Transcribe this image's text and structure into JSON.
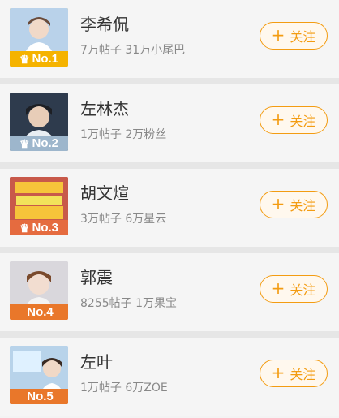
{
  "users": [
    {
      "rank": "No.1",
      "name": "李希侃",
      "stats": "7万帖子 31万小尾巴",
      "follow": "关注",
      "crown": "♛",
      "rank_color": "#f5b300",
      "avatar_bg": "#b9d2ea"
    },
    {
      "rank": "No.2",
      "name": "左林杰",
      "stats": "1万帖子 2万粉丝",
      "follow": "关注",
      "crown": "♛",
      "rank_color": "#9db6cc",
      "avatar_bg": "#2e3b4d"
    },
    {
      "rank": "No.3",
      "name": "胡文煊",
      "stats": "3万帖子 6万星云",
      "follow": "关注",
      "crown": "♛",
      "rank_color": "#e56b3f",
      "avatar_bg": "#c8594a"
    },
    {
      "rank": "No.4",
      "name": "郭震",
      "stats": "8255帖子 1万果宝",
      "follow": "关注",
      "crown": "",
      "rank_color": "#e9772a",
      "avatar_bg": "#d9d7dc"
    },
    {
      "rank": "No.5",
      "name": "左叶",
      "stats": "1万帖子 6万ZOE",
      "follow": "关注",
      "crown": "",
      "rank_color": "#e9772a",
      "avatar_bg": "#b8d3ea"
    }
  ]
}
